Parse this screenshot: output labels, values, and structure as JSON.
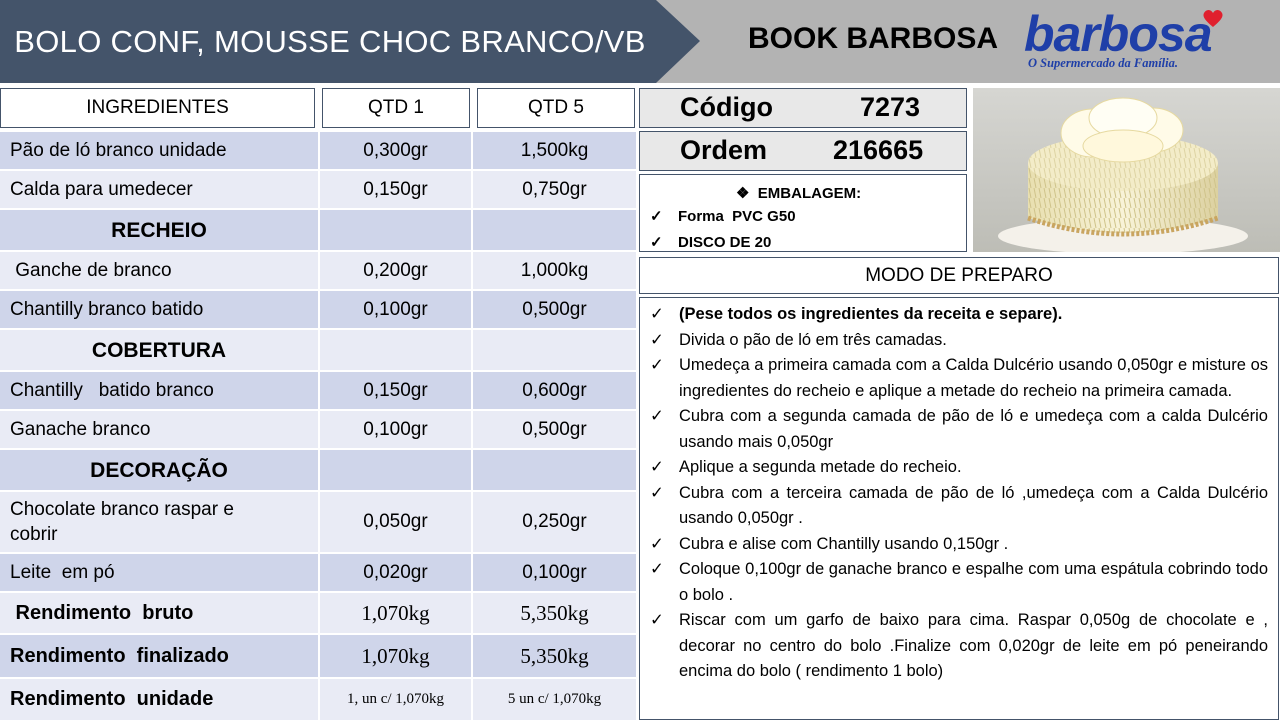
{
  "header": {
    "title": "BOLO CONF, MOUSSE CHOC BRANCO/VB",
    "book": "BOOK BARBOSA",
    "logo_word": "barbosa",
    "logo_tagline": "O Supermercado da Família.",
    "colors": {
      "title_bar": "#44546a",
      "bar": "#b3b3b3",
      "logo": "#1f3fa8",
      "heart": "#e0202e"
    }
  },
  "table": {
    "headers": [
      "INGREDIENTES",
      "QTD 1",
      "QTD 5"
    ],
    "rows": [
      {
        "name": "Pão de ló branco unidade",
        "q1": "0,300gr",
        "q5": "1,500kg"
      },
      {
        "name": "Calda para umedecer",
        "q1": "0,150gr",
        "q5": "0,750gr"
      },
      {
        "name": "RECHEIO",
        "q1": "",
        "q5": ""
      },
      {
        "name": " Ganche de branco",
        "q1": "0,200gr",
        "q5": "1,000kg"
      },
      {
        "name": "Chantilly branco batido",
        "q1": "0,100gr",
        "q5": "0,500gr"
      },
      {
        "name": "COBERTURA",
        "q1": "",
        "q5": ""
      },
      {
        "name": "Chantilly   batido branco",
        "q1": "0,150gr",
        "q5": "0,600gr"
      },
      {
        "name": "Ganache branco",
        "q1": "0,100gr",
        "q5": "0,500gr"
      },
      {
        "name": "DECORAÇÃO",
        "q1": "",
        "q5": ""
      },
      {
        "name": "Chocolate branco raspar e cobrir",
        "q1": "0,050gr",
        "q5": "0,250gr"
      },
      {
        "name": "Leite  em pó",
        "q1": "0,020gr",
        "q5": "0,100gr"
      },
      {
        "name": " Rendimento  bruto",
        "q1": "1,070kg",
        "q5": "5,350kg"
      },
      {
        "name": "Rendimento  finalizado",
        "q1": "1,070kg",
        "q5": "5,350kg"
      },
      {
        "name": "Rendimento  unidade",
        "q1": "1, un c/ 1,070kg",
        "q5": "5 un c/ 1,070kg"
      }
    ]
  },
  "codigo": {
    "label": "Código",
    "value": "7273"
  },
  "ordem": {
    "label": "Ordem",
    "value": "216665"
  },
  "embalagem": {
    "title": "EMBALAGEM:",
    "items": [
      "Forma  PVC G50",
      "DISCO DE 20"
    ]
  },
  "modo_preparo": {
    "title": "MODO DE PREPARO",
    "steps": [
      "(Pese todos os ingredientes da receita e separe).",
      "Divida o pão de ló em três camadas.",
      "Umedeça a primeira camada com a Calda Dulcério usando 0,050gr e misture os  ingredientes do recheio e aplique a metade do recheio na primeira  camada.",
      "Cubra com a segunda camada de pão de ló e umedeça com a calda Dulcério usando mais 0,050gr",
      "Aplique a segunda metade do recheio.",
      "Cubra com a terceira camada de pão de ló ,umedeça com a Calda Dulcério usando 0,050gr .",
      "Cubra e alise com Chantilly  usando 0,150gr .",
      "Coloque  0,100gr de ganache branco e espalhe com uma espátula cobrindo todo o bolo .",
      "Riscar com um garfo de baixo para cima. Raspar  0,050g de chocolate e , decorar  no centro do bolo .Finalize com 0,020gr de leite em pó peneirando encima do bolo ( rendimento 1 bolo)"
    ]
  }
}
